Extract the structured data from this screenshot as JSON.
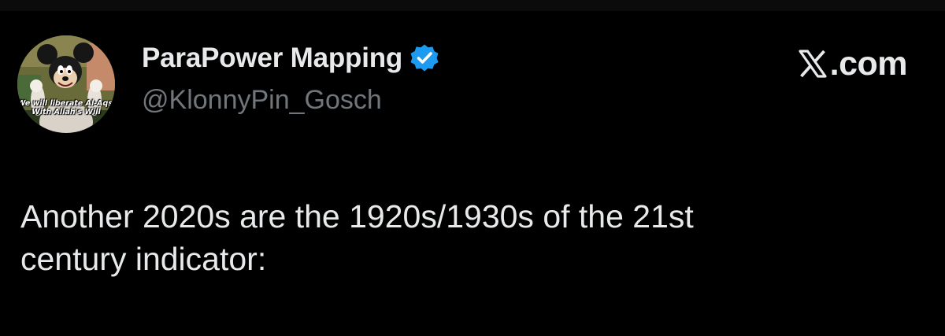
{
  "tweet": {
    "author": {
      "display_name": "ParaPower Mapping",
      "handle": "@KlonnyPin_Gosch",
      "verified": true,
      "verified_icon": "verified-badge-icon",
      "avatar_caption_line1": "We will liberate Al-Aqsa",
      "avatar_caption_line2": "With Allah's Will"
    },
    "text": "Another 2020s are the 1920s/1930s of the 21st\ncentury indicator:"
  },
  "brand": {
    "logo_icon": "x-logo-icon",
    "suffix": ".com"
  },
  "colors": {
    "background": "#000000",
    "primary_text": "#e7e9ea",
    "secondary_text": "#71767b",
    "verified_badge": "#1d9bf0"
  }
}
